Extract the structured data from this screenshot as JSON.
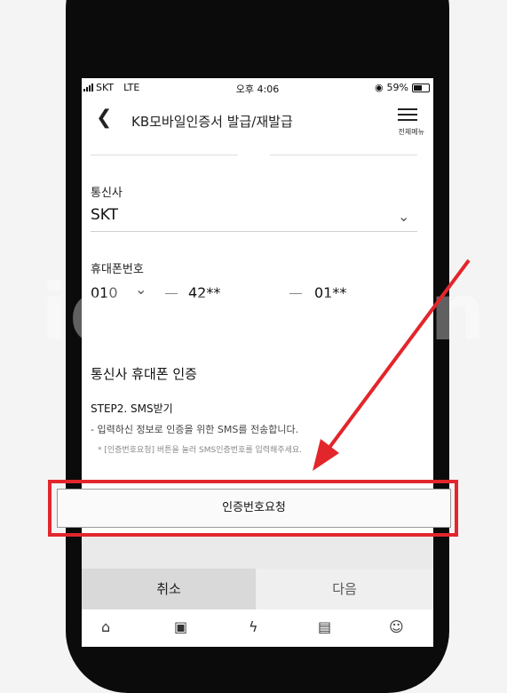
{
  "status_bar": {
    "carrier": "SKT",
    "network": "LTE",
    "time": "오후 4:06",
    "battery": "59%"
  },
  "header": {
    "title": "KB모바일인증서 발급/재발급",
    "menu_label": "전체메뉴"
  },
  "form": {
    "carrier_label": "통신사",
    "carrier_value": "SKT",
    "phone_label": "휴대폰번호",
    "phone_prefix": "010",
    "phone_middle": "42**",
    "phone_last": "01**"
  },
  "verification": {
    "section_title": "통신사 휴대폰 인증",
    "step_title": "STEP2. SMS받기",
    "step_desc": "- 입력하신 정보로 인증을 위한 SMS를 전송합니다.",
    "step_note": "* [인증번호요청] 버튼을 눌러 SMS인증번호를 입력해주세요."
  },
  "actions": {
    "request_label": "인증번호요청",
    "cancel_label": "취소",
    "next_label": "다음"
  },
  "tabbar": {
    "icons": [
      "home-icon",
      "wallet-icon",
      "bolt-icon",
      "calendar-icon",
      "face-icon"
    ]
  },
  "watermark": "ideainven",
  "colors": {
    "highlight": "#e2262c",
    "arrow": "#e2262c"
  }
}
